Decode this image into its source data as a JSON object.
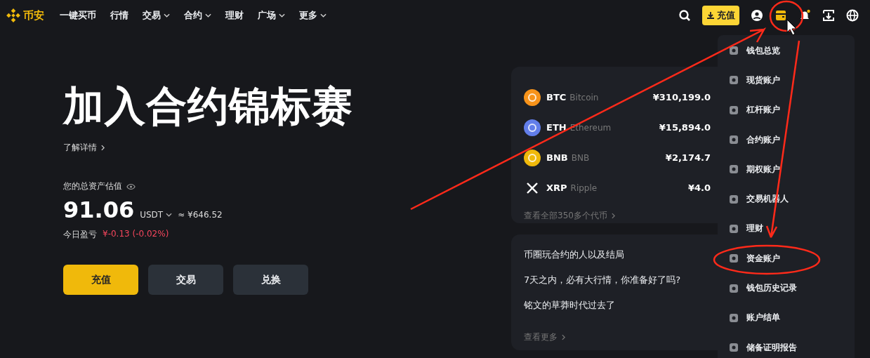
{
  "logo": {
    "name": "币安"
  },
  "nav": [
    {
      "label": "一键买币",
      "dropdown": false
    },
    {
      "label": "行情",
      "dropdown": false
    },
    {
      "label": "交易",
      "dropdown": true
    },
    {
      "label": "合约",
      "dropdown": true
    },
    {
      "label": "理财",
      "dropdown": false
    },
    {
      "label": "广场",
      "dropdown": true
    },
    {
      "label": "更多",
      "dropdown": true
    }
  ],
  "header": {
    "deposit_button": "充值"
  },
  "hero": {
    "title": "加入合约锦标赛",
    "learn_more": "了解详情",
    "balance_label": "您的总资产估值",
    "balance": "91.06",
    "currency": "USDT",
    "fiat": "≈ ¥646.52",
    "pnl_label": "今日盈亏",
    "pnl": "¥-0.13 (-0.02%)",
    "buttons": [
      {
        "label": "充值",
        "kind": "primary"
      },
      {
        "label": "交易",
        "kind": "secondary"
      },
      {
        "label": "兑换",
        "kind": "secondary"
      }
    ]
  },
  "coins": {
    "items": [
      {
        "symbol": "BTC",
        "name": "Bitcoin",
        "price": "¥310,199.0",
        "kind": "disc",
        "color": "#f7931a"
      },
      {
        "symbol": "ETH",
        "name": "Ethereum",
        "price": "¥15,894.0",
        "kind": "disc",
        "color": "#627eea"
      },
      {
        "symbol": "BNB",
        "name": "BNB",
        "price": "¥2,174.7",
        "kind": "disc",
        "color": "#f0b90b"
      },
      {
        "symbol": "XRP",
        "name": "Ripple",
        "price": "¥4.0",
        "kind": "cross",
        "color": "#ffffff"
      }
    ],
    "link": "查看全部350多个代币"
  },
  "news": {
    "items": [
      "币圈玩合约的人以及结局",
      "7天之内，必有大行情，你准备好了吗?",
      "铭文的草莽时代过去了"
    ],
    "link": "查看更多"
  },
  "wallet_menu": {
    "items": [
      "钱包总览",
      "现货账户",
      "杠杆账户",
      "合约账户",
      "期权账户",
      "交易机器人",
      "理财",
      "资金账户",
      "钱包历史记录",
      "账户结单",
      "储备证明报告"
    ]
  }
}
